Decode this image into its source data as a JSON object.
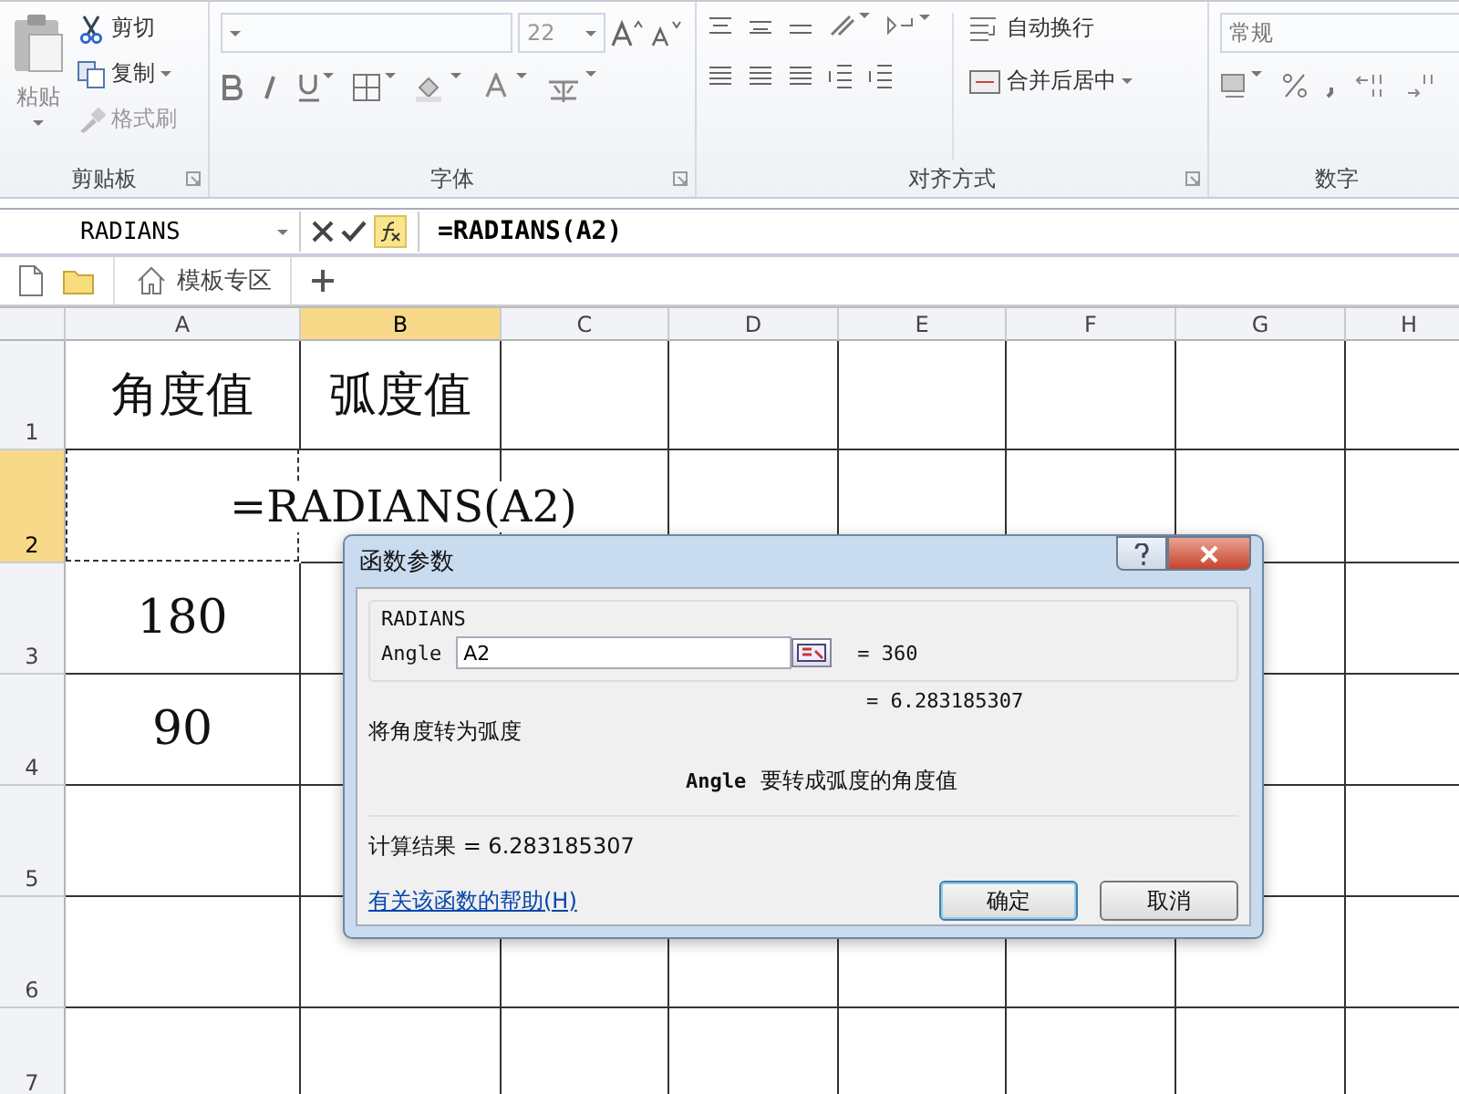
{
  "ribbon": {
    "clipboard": {
      "paste": "粘贴",
      "cut": "剪切",
      "copy": "复制",
      "format_painter": "格式刷",
      "label": "剪贴板"
    },
    "font": {
      "size": "22",
      "label": "字体"
    },
    "alignment": {
      "wrap": "自动换行",
      "merge": "合并后居中",
      "label": "对齐方式"
    },
    "number": {
      "format": "常规",
      "label": "数字"
    }
  },
  "formula_bar": {
    "name_box": "RADIANS",
    "formula": "=RADIANS(A2)"
  },
  "tab_bar": {
    "tab": "模板专区"
  },
  "sheet": {
    "columns": [
      {
        "label": "A",
        "selected": false
      },
      {
        "label": "B",
        "selected": true
      },
      {
        "label": "C",
        "selected": false
      },
      {
        "label": "D",
        "selected": false
      },
      {
        "label": "E",
        "selected": false
      },
      {
        "label": "F",
        "selected": false
      },
      {
        "label": "G",
        "selected": false
      },
      {
        "label": "H",
        "selected": false
      }
    ],
    "rows": [
      {
        "label": "1",
        "selected": false,
        "cells": [
          {
            "text": "角度值"
          },
          {
            "text": "弧度值"
          }
        ]
      },
      {
        "label": "2",
        "selected": true,
        "cells": [
          {
            "text": "=RADIANS(A2)",
            "marquee": true,
            "spill": true
          }
        ]
      },
      {
        "label": "3",
        "selected": false,
        "cells": [
          {
            "text": "180"
          }
        ]
      },
      {
        "label": "4",
        "selected": false,
        "cells": [
          {
            "text": "90"
          }
        ]
      },
      {
        "label": "5",
        "selected": false,
        "cells": []
      },
      {
        "label": "6",
        "selected": false,
        "cells": []
      },
      {
        "label": "7",
        "selected": false,
        "cells": []
      }
    ]
  },
  "dialog": {
    "title": "函数参数",
    "function": "RADIANS",
    "arg_label": "Angle",
    "arg_value": "A2",
    "arg_result": "= 360",
    "result_preview": "= 6.283185307",
    "description": "将角度转为弧度",
    "arg_name": "Angle",
    "arg_help": "要转成弧度的角度值",
    "formula_result": "计算结果 = 6.283185307",
    "help_link": "有关该函数的帮助(H)",
    "ok": "确定",
    "cancel": "取消"
  }
}
